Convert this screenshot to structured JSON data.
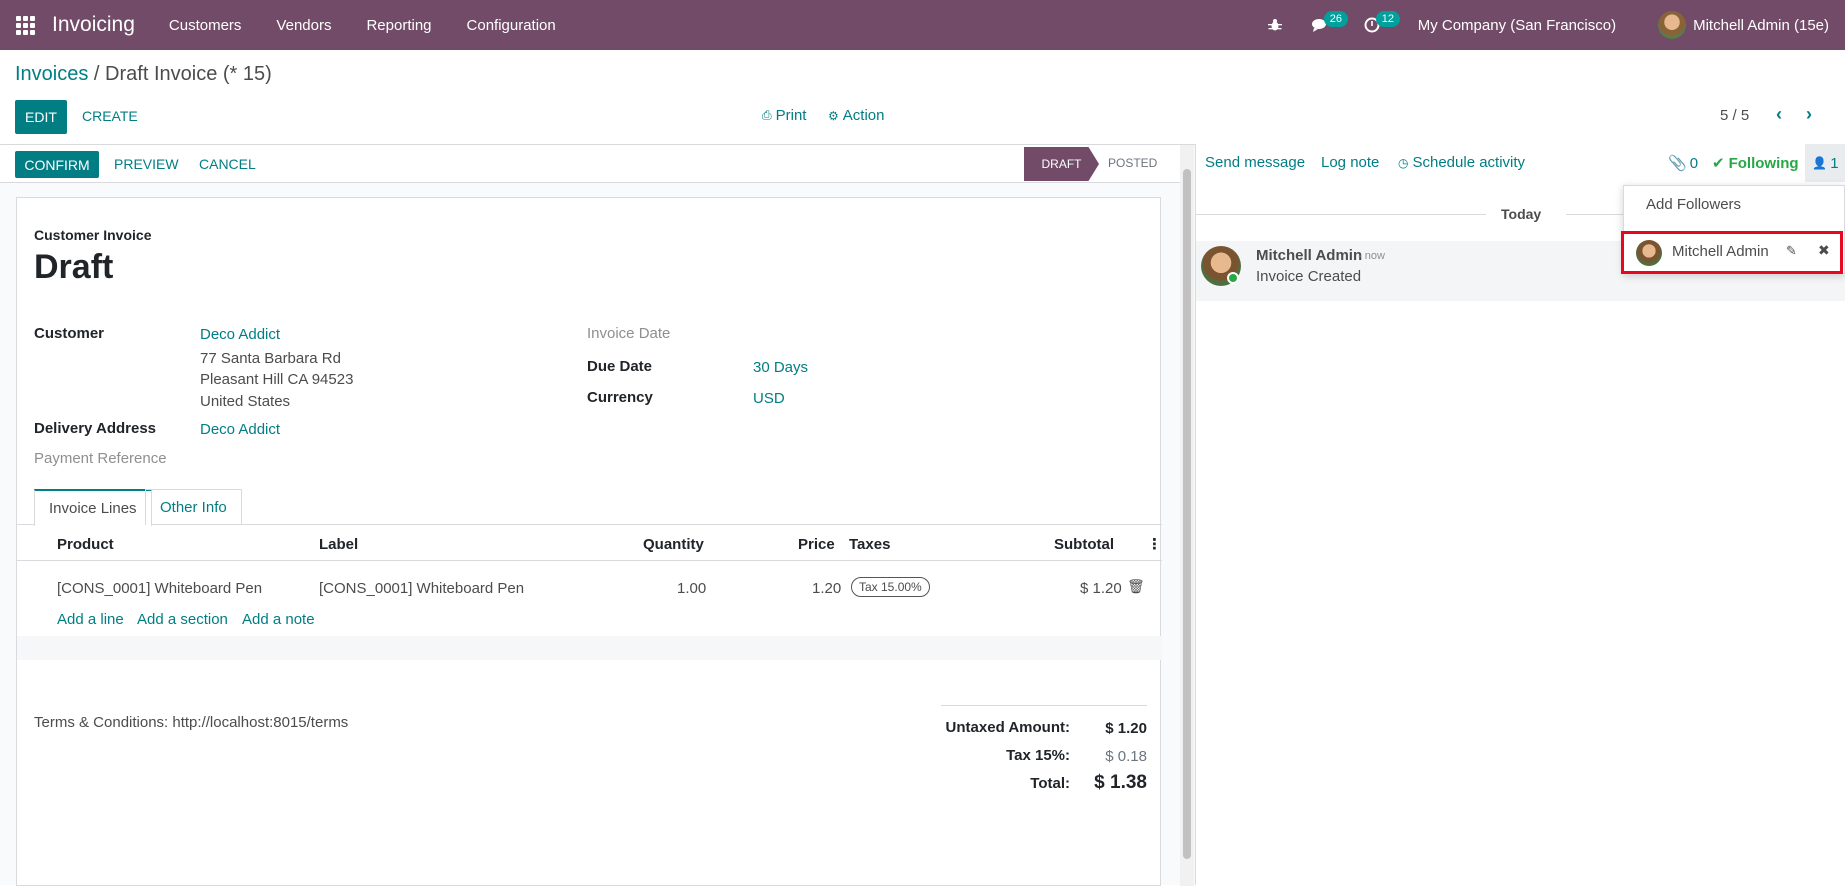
{
  "navbar": {
    "app_name": "Invoicing",
    "menu": [
      "Customers",
      "Vendors",
      "Reporting",
      "Configuration"
    ],
    "messages_count": "26",
    "activities_count": "12",
    "company": "My Company (San Francisco)",
    "user": "Mitchell Admin (15e)"
  },
  "breadcrumb": {
    "parent": "Invoices",
    "sep": " / ",
    "current": "Draft Invoice (* 15)"
  },
  "control": {
    "edit": "EDIT",
    "create": "CREATE",
    "print": "Print",
    "action": "Action",
    "pager": "5 / 5"
  },
  "statusbar": {
    "confirm": "CONFIRM",
    "preview": "PREVIEW",
    "cancel": "CANCEL",
    "draft": "DRAFT",
    "posted": "POSTED"
  },
  "invoice": {
    "type": "Customer Invoice",
    "name": "Draft",
    "customer_label": "Customer",
    "customer": "Deco Addict",
    "address": [
      "77 Santa Barbara Rd",
      "Pleasant Hill CA 94523",
      "United States"
    ],
    "delivery_label": "Delivery Address",
    "delivery": "Deco Addict",
    "payment_ref_label": "Payment Reference",
    "invoice_date_label": "Invoice Date",
    "due_date_label": "Due Date",
    "due_date": "30 Days",
    "currency_label": "Currency",
    "currency": "USD"
  },
  "tabs": [
    "Invoice Lines",
    "Other Info"
  ],
  "lines": {
    "headers": [
      "Product",
      "Label",
      "Quantity",
      "Price",
      "Taxes",
      "Subtotal"
    ],
    "rows": [
      {
        "product": "[CONS_0001] Whiteboard Pen",
        "label": "[CONS_0001] Whiteboard Pen",
        "quantity": "1.00",
        "price": "1.20",
        "tax": "Tax 15.00%",
        "subtotal": "$ 1.20"
      }
    ],
    "add_line": "Add a line",
    "add_section": "Add a section",
    "add_note": "Add a note"
  },
  "terms": "Terms & Conditions: http://localhost:8015/terms",
  "totals": {
    "untaxed_label": "Untaxed Amount:",
    "untaxed": "$ 1.20",
    "tax_label": "Tax 15%:",
    "tax": "$ 0.18",
    "total_label": "Total:",
    "total": "$ 1.38"
  },
  "chatter": {
    "send_message": "Send message",
    "log_note": "Log note",
    "schedule_activity": "Schedule activity",
    "attachments": "0",
    "following": "Following",
    "followers_count": "1",
    "date_separator": "Today",
    "message": {
      "author": "Mitchell Admin",
      "time": "- now",
      "body": "Invoice Created"
    },
    "followers_dropdown": {
      "add_followers": "Add Followers",
      "follower": "Mitchell Admin"
    }
  },
  "colors": {
    "brand": "#714b67",
    "accent": "#017e84",
    "highlight": "#e6081f"
  }
}
